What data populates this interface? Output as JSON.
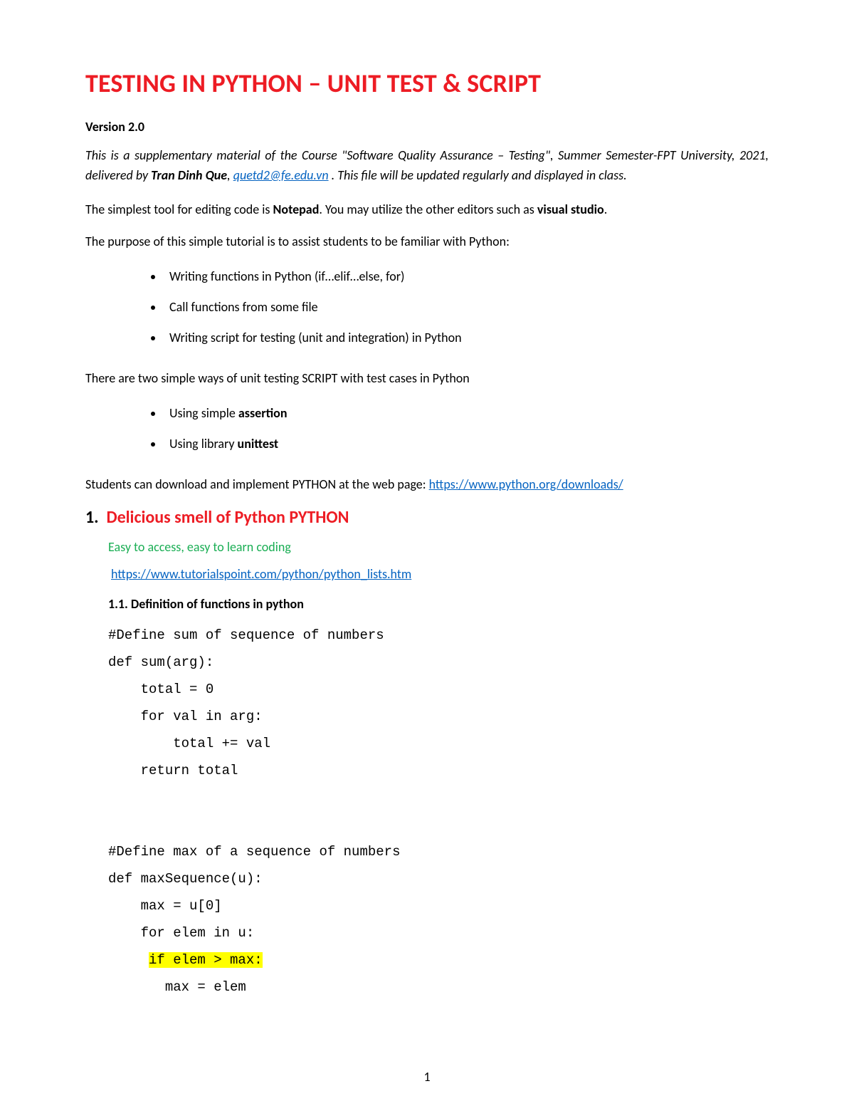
{
  "title": "TESTING IN PYTHON – UNIT TEST & SCRIPT",
  "version": "Version 2.0",
  "intro": {
    "part1": "This is a supplementary material of the Course \"Software Quality Assurance – Testing\", Summer Semester-FPT University, 2021, delivered by ",
    "author": "Tran Dinh Que",
    "sep": ", ",
    "email": "quetd2@fe.edu.vn",
    "part2": " . This file will be updated regularly and displayed in class."
  },
  "line_editor": {
    "a": "The simplest tool for editing code is ",
    "b1": "Notepad",
    "b": ". You may utilize the other editors such as ",
    "b2": "visual studio",
    "c": "."
  },
  "purpose": "The purpose of this simple tutorial is to assist students to be familiar with Python:",
  "bullets1": [
    "Writing functions in Python (if…elif…else, for)",
    "Call functions from some file",
    "Writing script for testing (unit and integration) in Python"
  ],
  "two_ways": "There are two simple ways of unit testing SCRIPT with test cases in Python",
  "bullets2": [
    {
      "pre": "Using simple ",
      "bold": "assertion"
    },
    {
      "pre": "Using library ",
      "bold": "unittest"
    }
  ],
  "download": {
    "text": "Students can download and implement PYTHON at the web page: ",
    "url": "https://www.python.org/downloads/"
  },
  "section1": {
    "num": "1.",
    "title": "Delicious  smell of Python PYTHON",
    "green": "Easy to access, easy to learn coding",
    "tut_url": "https://www.tutorialspoint.com/python/python_lists.htm",
    "sub": "1.1. Definition of functions in python"
  },
  "code": {
    "l1": "#Define sum of sequence of numbers",
    "l2": "def sum(arg):",
    "l3": "    total = 0",
    "l4": "    for val in arg:",
    "l5": "        total += val",
    "l6": "    return total",
    "blank": "",
    "l7": "#Define max of a sequence of numbers",
    "l8": "def maxSequence(u):",
    "l9": "    max = u[0]",
    "l10": "    for elem in u:",
    "l11_pre": "     ",
    "l11_hl": "if elem > max:",
    "l12": "       max = elem"
  },
  "page_number": "1"
}
